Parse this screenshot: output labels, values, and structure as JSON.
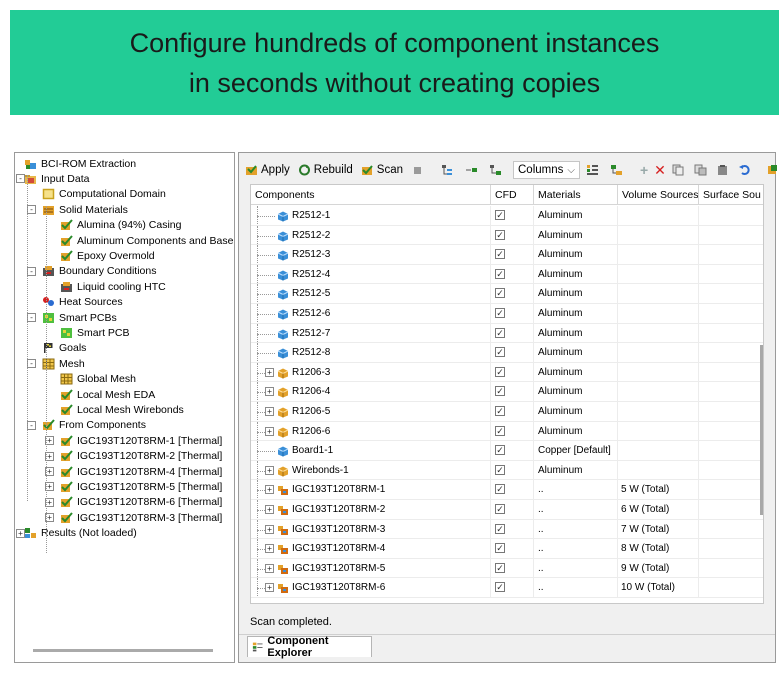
{
  "banner": {
    "line1": "Configure hundreds of component instances",
    "line2": "in seconds without creating copies"
  },
  "tree": {
    "items": [
      {
        "label": "BCI-ROM Extraction",
        "icon": "project-icon",
        "level": 0,
        "expander": ""
      },
      {
        "label": "Input Data",
        "icon": "input-folder-icon",
        "level": 0,
        "expander": "-"
      },
      {
        "label": "Computational Domain",
        "icon": "domain-box-icon",
        "level": 1,
        "expander": ""
      },
      {
        "label": "Solid Materials",
        "icon": "materials-icon",
        "level": 1,
        "expander": "-"
      },
      {
        "label": "Alumina (94%) Casing",
        "icon": "material-icon",
        "level": 2,
        "expander": ""
      },
      {
        "label": "Aluminum Components and Base",
        "icon": "material-icon",
        "level": 2,
        "expander": ""
      },
      {
        "label": "Epoxy Overmold",
        "icon": "material-icon",
        "level": 2,
        "expander": ""
      },
      {
        "label": "Boundary Conditions",
        "icon": "boundary-icon",
        "level": 1,
        "expander": "-"
      },
      {
        "label": "Liquid cooling HTC",
        "icon": "boundary-icon",
        "level": 2,
        "expander": ""
      },
      {
        "label": "Heat Sources",
        "icon": "heat-source-icon",
        "level": 1,
        "expander": ""
      },
      {
        "label": "Smart PCBs",
        "icon": "pcb-icon",
        "level": 1,
        "expander": "-"
      },
      {
        "label": "Smart PCB",
        "icon": "pcb-icon",
        "level": 2,
        "expander": ""
      },
      {
        "label": "Goals",
        "icon": "goals-icon",
        "level": 1,
        "expander": ""
      },
      {
        "label": "Mesh",
        "icon": "mesh-icon",
        "level": 1,
        "expander": "-"
      },
      {
        "label": "Global Mesh",
        "icon": "mesh-icon",
        "level": 2,
        "expander": ""
      },
      {
        "label": "Local Mesh EDA",
        "icon": "material-icon",
        "level": 2,
        "expander": ""
      },
      {
        "label": "Local Mesh Wirebonds",
        "icon": "material-icon",
        "level": 2,
        "expander": ""
      },
      {
        "label": "From Components",
        "icon": "material-icon",
        "level": 1,
        "expander": "-"
      },
      {
        "label": "IGC193T120T8RM-1 [Thermal]",
        "icon": "material-icon",
        "level": 2,
        "expander": "+"
      },
      {
        "label": "IGC193T120T8RM-2 [Thermal]",
        "icon": "material-icon",
        "level": 2,
        "expander": "+"
      },
      {
        "label": "IGC193T120T8RM-4 [Thermal]",
        "icon": "material-icon",
        "level": 2,
        "expander": "+"
      },
      {
        "label": "IGC193T120T8RM-5 [Thermal]",
        "icon": "material-icon",
        "level": 2,
        "expander": "+"
      },
      {
        "label": "IGC193T120T8RM-6 [Thermal]",
        "icon": "material-icon",
        "level": 2,
        "expander": "+"
      },
      {
        "label": "IGC193T120T8RM-3 [Thermal]",
        "icon": "material-icon",
        "level": 2,
        "expander": "+"
      },
      {
        "label": "Results (Not loaded)",
        "icon": "results-icon",
        "level": 0,
        "expander": "+"
      }
    ]
  },
  "toolbar": {
    "apply_label": "Apply",
    "rebuild_label": "Rebuild",
    "scan_label": "Scan",
    "columns_label": "Columns",
    "columns_arrow": "⌵",
    "add_icon": "plus-icon",
    "delete_icon": "delete-x-icon",
    "delete_color": "#d62020"
  },
  "grid": {
    "headers": [
      "Components",
      "CFD",
      "Materials",
      "Volume Sources",
      "Surface Sou"
    ],
    "rows": [
      {
        "name": "R2512-1",
        "expander": "",
        "icon": "part-blue-icon",
        "cfd": "☑",
        "material": "Aluminum",
        "volume": ""
      },
      {
        "name": "R2512-2",
        "expander": "",
        "icon": "part-blue-icon",
        "cfd": "☑",
        "material": "Aluminum",
        "volume": ""
      },
      {
        "name": "R2512-3",
        "expander": "",
        "icon": "part-blue-icon",
        "cfd": "☑",
        "material": "Aluminum",
        "volume": ""
      },
      {
        "name": "R2512-4",
        "expander": "",
        "icon": "part-blue-icon",
        "cfd": "☑",
        "material": "Aluminum",
        "volume": ""
      },
      {
        "name": "R2512-5",
        "expander": "",
        "icon": "part-blue-icon",
        "cfd": "☑",
        "material": "Aluminum",
        "volume": ""
      },
      {
        "name": "R2512-6",
        "expander": "",
        "icon": "part-blue-icon",
        "cfd": "☑",
        "material": "Aluminum",
        "volume": ""
      },
      {
        "name": "R2512-7",
        "expander": "",
        "icon": "part-blue-icon",
        "cfd": "☑",
        "material": "Aluminum",
        "volume": ""
      },
      {
        "name": "R2512-8",
        "expander": "",
        "icon": "part-blue-icon",
        "cfd": "☑",
        "material": "Aluminum",
        "volume": ""
      },
      {
        "name": "R1206-3",
        "expander": "+",
        "icon": "assembly-orange-icon",
        "cfd": "☑",
        "material": "Aluminum",
        "volume": ""
      },
      {
        "name": "R1206-4",
        "expander": "+",
        "icon": "assembly-orange-icon",
        "cfd": "☑",
        "material": "Aluminum",
        "volume": ""
      },
      {
        "name": "R1206-5",
        "expander": "+",
        "icon": "assembly-orange-icon",
        "cfd": "☑",
        "material": "Aluminum",
        "volume": ""
      },
      {
        "name": "R1206-6",
        "expander": "+",
        "icon": "assembly-orange-icon",
        "cfd": "☑",
        "material": "Aluminum",
        "volume": ""
      },
      {
        "name": "Board1-1",
        "expander": "",
        "icon": "part-blue-icon",
        "cfd": "☑",
        "material": "Copper [Default]",
        "volume": ""
      },
      {
        "name": "Wirebonds-1",
        "expander": "+",
        "icon": "assembly-orange-icon",
        "cfd": "☑",
        "material": "Aluminum",
        "volume": ""
      },
      {
        "name": "IGC193T120T8RM-1",
        "expander": "+",
        "icon": "assembly-multi-icon",
        "cfd": "☑",
        "material": "..",
        "volume": "5 W (Total)"
      },
      {
        "name": "IGC193T120T8RM-2",
        "expander": "+",
        "icon": "assembly-multi-icon",
        "cfd": "☑",
        "material": "..",
        "volume": "6 W (Total)"
      },
      {
        "name": "IGC193T120T8RM-3",
        "expander": "+",
        "icon": "assembly-multi-icon",
        "cfd": "☑",
        "material": "..",
        "volume": "7 W (Total)"
      },
      {
        "name": "IGC193T120T8RM-4",
        "expander": "+",
        "icon": "assembly-multi-icon",
        "cfd": "☑",
        "material": "..",
        "volume": "8 W (Total)"
      },
      {
        "name": "IGC193T120T8RM-5",
        "expander": "+",
        "icon": "assembly-multi-icon",
        "cfd": "☑",
        "material": "..",
        "volume": "9 W (Total)"
      },
      {
        "name": "IGC193T120T8RM-6",
        "expander": "+",
        "icon": "assembly-multi-icon",
        "cfd": "☑",
        "material": "..",
        "volume": "10 W (Total)"
      }
    ]
  },
  "status": "Scan completed.",
  "bottom_tab": {
    "label": "Component Explorer",
    "icon": "component-explorer-icon"
  },
  "colors": {
    "banner_bg": "#22cc96",
    "part_blue": "#3a8fd8",
    "assembly_orange": "#e3a12a"
  }
}
